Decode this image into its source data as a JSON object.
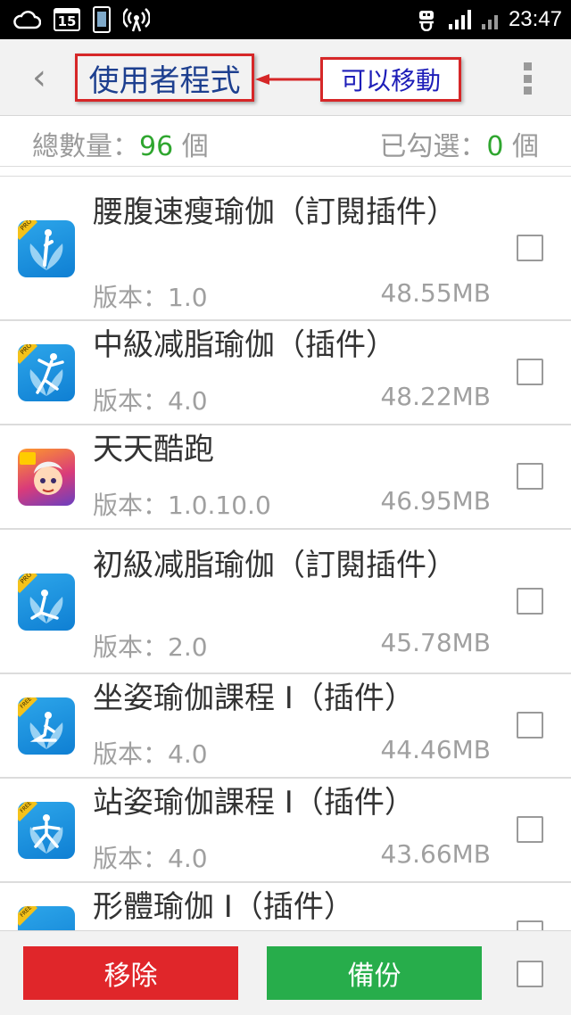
{
  "statusbar": {
    "time": "23:47",
    "calendar_day": "15",
    "icons": [
      "cloud-icon",
      "calendar-icon",
      "phone-device-icon",
      "wifi-hotspot-icon",
      "usb-icon",
      "signal-icon",
      "no-signal-icon"
    ]
  },
  "header": {
    "back_icon": "‹",
    "title": "使用者程式",
    "annotation": "可以移動"
  },
  "summary": {
    "total_label": "總數量：",
    "total_count": "96",
    "total_unit": "個",
    "selected_label": "已勾選：",
    "selected_count": "0",
    "selected_unit": "個"
  },
  "apps": [
    {
      "name": "腰腹速瘦瑜伽（訂閱插件）",
      "version": "版本：1.0",
      "size": "48.55MB",
      "badge": "PRO",
      "icon": "yoga-icon"
    },
    {
      "name": "中級减脂瑜伽（插件）",
      "version": "版本：4.0",
      "size": "48.22MB",
      "badge": "PRO",
      "icon": "yoga-icon"
    },
    {
      "name": "天天酷跑",
      "version": "版本：1.0.10.0",
      "size": "46.95MB",
      "badge": "",
      "icon": "game-icon"
    },
    {
      "name": "初級减脂瑜伽（訂閱插件）",
      "version": "版本：2.0",
      "size": "45.78MB",
      "badge": "PRO",
      "icon": "yoga-icon"
    },
    {
      "name": "坐姿瑜伽課程 I（插件）",
      "version": "版本：4.0",
      "size": "44.46MB",
      "badge": "FREE",
      "icon": "yoga-icon"
    },
    {
      "name": "站姿瑜伽課程 I（插件）",
      "version": "版本：4.0",
      "size": "43.66MB",
      "badge": "FREE",
      "icon": "yoga-icon"
    },
    {
      "name": "形體瑜伽 I（插件）",
      "version": "",
      "size": "",
      "badge": "FREE",
      "icon": "yoga-icon"
    }
  ],
  "bottombar": {
    "remove_label": "移除",
    "backup_label": "備份"
  },
  "colors": {
    "accent_green": "#2fa62f",
    "remove_red": "#e0262a",
    "backup_green": "#27ad4b",
    "annotation_red": "#d62728",
    "title_blue": "#1d3f8f"
  }
}
